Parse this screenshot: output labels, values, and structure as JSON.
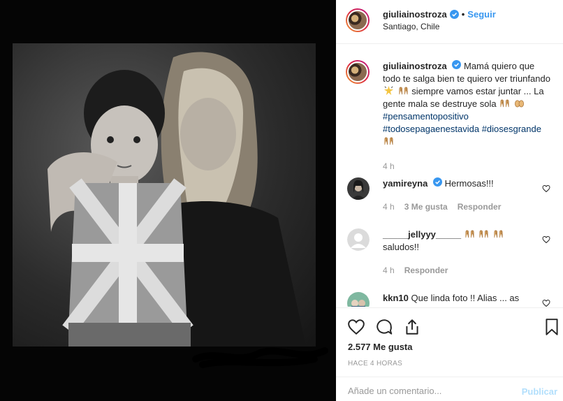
{
  "post": {
    "username": "giuliainostroza",
    "follow_label": "Seguir",
    "separator": "•",
    "location": "Santiago, Chile"
  },
  "caption": {
    "username": "giuliainostroza",
    "text_1": "Mamá quiero que todo te salga bien te quiero ver triunfando",
    "text_2": "siempre vamos estar juntar ... La gente mala se destruye sola",
    "tags": [
      "#pensamentopositivo",
      "#todosepagaenestavida",
      "#diosesgrande"
    ],
    "time": "4 h"
  },
  "comments": [
    {
      "username": "yamireyna",
      "text": "Hermosas!!!",
      "time": "4 h",
      "likes": "3 Me gusta",
      "reply": "Responder"
    },
    {
      "username": "_____jellyyy_____",
      "text": "saludos!!",
      "time": "4 h",
      "reply": "Responder"
    },
    {
      "username": "kkn10",
      "text": "Que linda foto !! Alias ... as"
    }
  ],
  "actions": {
    "likes": "2.577 Me gusta",
    "posted": "HACE 4 HORAS"
  },
  "form": {
    "placeholder": "Añade un comentario...",
    "publish_label": "Publicar"
  },
  "icons": [
    "verified-icon",
    "heart-icon",
    "comment-icon",
    "share-icon",
    "bookmark-icon"
  ],
  "colors": {
    "link": "#3897f0",
    "tag": "#003569",
    "verified": "#3897f0",
    "muted": "#999999",
    "publish_disabled": "#b2dffc"
  }
}
